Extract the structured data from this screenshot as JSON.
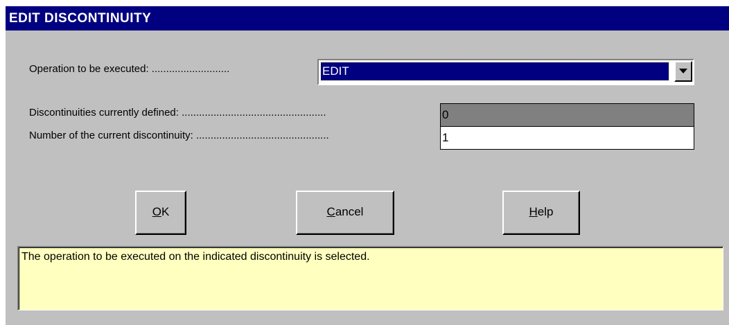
{
  "window": {
    "title": "EDIT DISCONTINUITY"
  },
  "form": {
    "operation": {
      "label": "Operation to be executed: ",
      "dots": "...........................",
      "value": "EDIT"
    },
    "defined": {
      "label": "Discontinuities currently defined: ",
      "dots": "..................................................",
      "value": "0"
    },
    "current": {
      "label": "Number of the current discontinuity: ",
      "dots": "..............................................",
      "value": "1"
    }
  },
  "buttons": {
    "ok": {
      "accel": "O",
      "rest": "K"
    },
    "cancel": {
      "accel": "C",
      "rest": "ancel"
    },
    "help": {
      "accel": "H",
      "rest": "elp"
    }
  },
  "status": {
    "text": "The operation to be executed on the indicated discontinuity is selected."
  },
  "colors": {
    "titlebar": "#000080",
    "dialog": "#c0c0c0",
    "status_bg": "#ffffc0",
    "selected_bg": "#000080",
    "readonly_bg": "#808080"
  }
}
